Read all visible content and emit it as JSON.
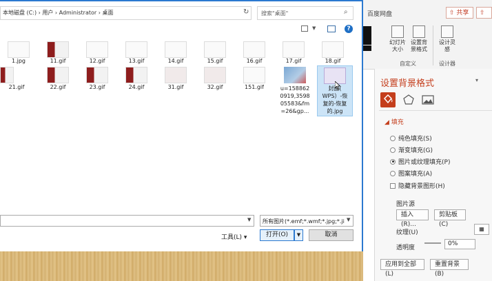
{
  "address_bar": {
    "path": "本地磁盘 (C:) › 用户 › Administrator › 桌面",
    "refresh_icon": "refresh-icon"
  },
  "search": {
    "placeholder": "搜索\"桌面\""
  },
  "toolbar": {
    "help": "?"
  },
  "files_row1": [
    "1.jpg",
    "11.gif",
    "12.gif",
    "13.gif",
    "14.gif",
    "15.gif",
    "16.gif",
    "17.gif",
    "18.gif"
  ],
  "files_row2": [
    "21.gif",
    "22.gif",
    "23.gif",
    "24.gif",
    "31.gif",
    "32.gif",
    "151.gif"
  ],
  "file_photo": {
    "line1": "u=158862",
    "line2": "0919,3598",
    "line3": "05583&fm",
    "line4": "=26&gp..."
  },
  "file_selected": {
    "line1": "封面(",
    "line2": "WPS）-恢",
    "line3": "复的-恢复",
    "line4": "的.jpg"
  },
  "dialog_bottom": {
    "file_type": "所有图片(*.emf;*.wmf;*.jpg;*.ji",
    "tools": "工具(L)",
    "open": "打开(O)",
    "cancel": "取消"
  },
  "ppt": {
    "cloud": "百度网盘",
    "share": "共享",
    "ribbon": {
      "slide_size": "幻灯片大小",
      "bg_format": "设置背景格式",
      "design_idea": "设计灵感",
      "group_custom": "自定义",
      "group_designer": "设计器"
    }
  },
  "format_pane": {
    "title": "设置背景格式",
    "fill_header": "填充",
    "options": [
      "纯色填充(S)",
      "渐变填充(G)",
      "图片或纹理填充(P)",
      "图案填充(A)"
    ],
    "selected_option": "图片或纹理填充(P)",
    "hide_bg": "隐藏背景图形(H)",
    "picture_source": "图片源",
    "insert": "插入(R)...",
    "clipboard": "剪贴板(C)",
    "texture": "纹理(U)",
    "transparency": "透明度",
    "transparency_value": "0%",
    "apply_all": "应用到全部(L)",
    "reset_bg": "重置背景(B)"
  }
}
